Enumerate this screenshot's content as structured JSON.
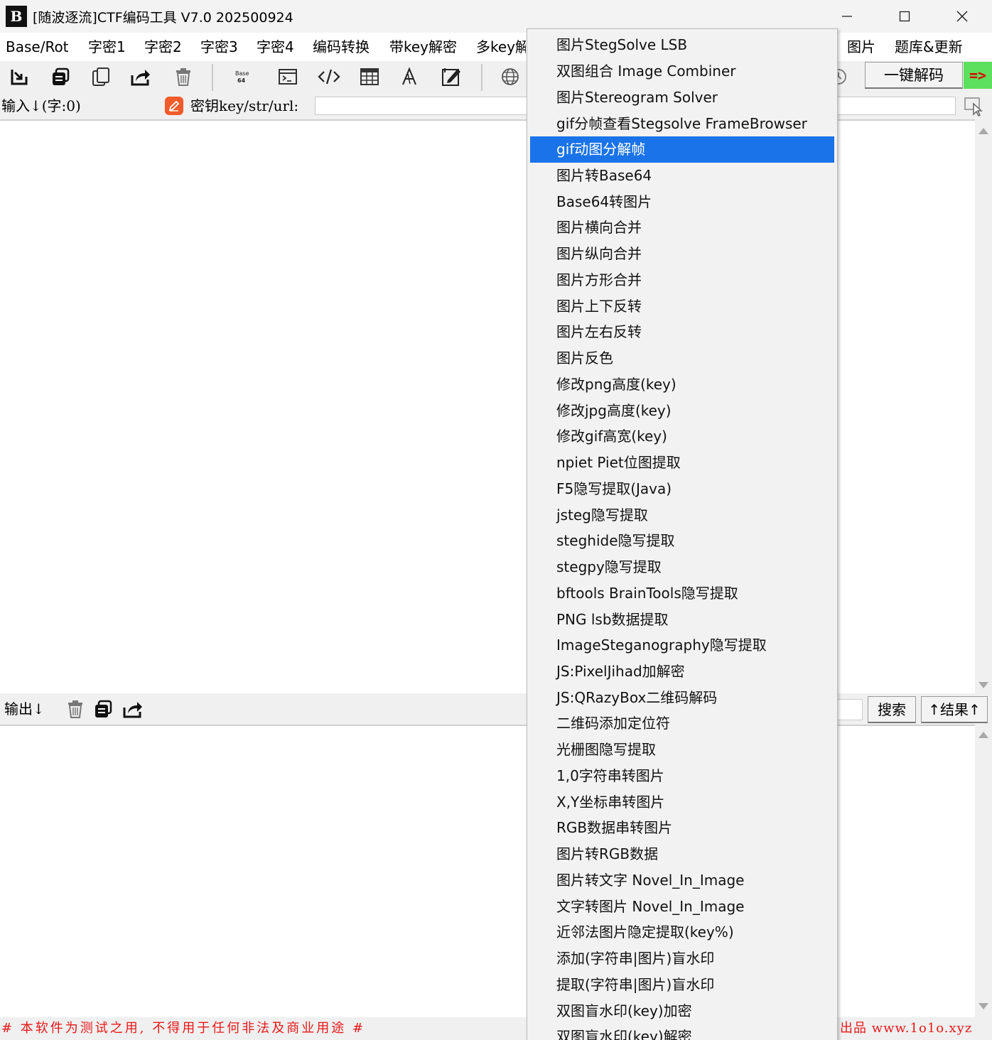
{
  "window": {
    "title": "[随波逐流]CTF编码工具 V7.0  202500924",
    "app_icon": "B",
    "controls": [
      "minimize-icon",
      "maximize-icon",
      "close-icon"
    ]
  },
  "menu": {
    "items": [
      "Base/Rot",
      "字密1",
      "字密2",
      "字密3",
      "字密4",
      "编码转换",
      "带key解密",
      "多key解",
      "图片",
      "题库&更新"
    ]
  },
  "toolbar": {
    "icons": [
      "import-icon",
      "copy-icon",
      "paste-icon",
      "share-icon",
      "trash-icon",
      "base64-icon",
      "terminal-icon",
      "code-icon",
      "table-icon",
      "font-icon",
      "edit-box-icon",
      "globe-icon",
      "clock-icon"
    ],
    "decode_button": "一键解码",
    "go_button": "=>"
  },
  "input": {
    "label": "输入↓(字:0)",
    "key_label": "密钥key/str/url:",
    "key_value": ""
  },
  "output": {
    "label": "输出↓",
    "search_button": "搜索",
    "result_button": "↑结果↑"
  },
  "status": {
    "left": "# 本软件为测试之用, 不得用于任何非法及商业用途 #",
    "right": "出品 www.1o1o.xyz"
  },
  "dropdown": {
    "selected_index": 4,
    "items": [
      "图片StegSolve LSB",
      "双图组合 Image Combiner",
      "图片Stereogram Solver",
      "gif分帧查看Stegsolve FrameBrowser",
      "gif动图分解帧",
      "图片转Base64",
      "Base64转图片",
      "图片横向合并",
      "图片纵向合并",
      "图片方形合并",
      "图片上下反转",
      "图片左右反转",
      "图片反色",
      "修改png高度(key)",
      "修改jpg高度(key)",
      "修改gif高宽(key)",
      "npiet Piet位图提取",
      "F5隐写提取(Java)",
      "jsteg隐写提取",
      "steghide隐写提取",
      "stegpy隐写提取",
      "bftools BrainTools隐写提取",
      "PNG lsb数据提取",
      "ImageSteganography隐写提取",
      "JS:PixelJihad加解密",
      "JS:QRazyBox二维码解码",
      "二维码添加定位符",
      "光栅图隐写提取",
      "1,0字符串转图片",
      "X,Y坐标串转图片",
      "RGB数据串转图片",
      "图片转RGB数据",
      "图片转文字 Novel_In_Image",
      "文字转图片 Novel_In_Image",
      "近邻法图片隐定提取(key%)",
      "添加(字符串|图片)盲水印",
      "提取(字符串|图片)盲水印",
      "双图盲水印(key)加密",
      "双图盲水印(key)解密"
    ]
  }
}
